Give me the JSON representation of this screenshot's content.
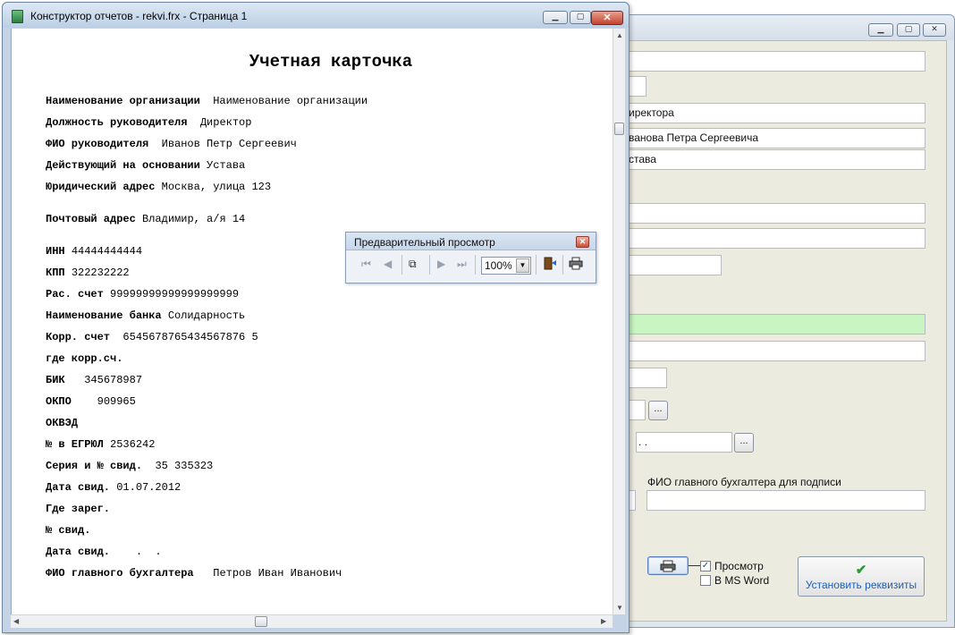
{
  "window": {
    "title": "Конструктор отчетов - rekvi.frx - Страница 1"
  },
  "report": {
    "title": "Учетная карточка",
    "lines": [
      {
        "label": "Наименование организации",
        "value": "Наименование организации"
      },
      {
        "label": "Должность руководителя",
        "value": "Директор"
      },
      {
        "label": "ФИО руководителя",
        "value": "Иванов Петр Сергеевич"
      },
      {
        "label": "Действующий на основании",
        "value": "Устава"
      },
      {
        "label": "Юридический адрес",
        "value": "Москва, улица 123"
      },
      {
        "label": "Почтовый адрес",
        "value": "Владимир, а/я 14"
      },
      {
        "label": "ИНН",
        "value": "44444444444"
      },
      {
        "label": "КПП",
        "value": "322232222"
      },
      {
        "label": "Рас. счет",
        "value": "99999999999999999999"
      },
      {
        "label": "Наименование банка",
        "value": "Солидарность"
      },
      {
        "label": "Корр. счет",
        "value": "6545678765434567876 5"
      },
      {
        "label": "где корр.сч.",
        "value": ""
      },
      {
        "label": "БИК",
        "value": "345678987"
      },
      {
        "label": "ОКПО",
        "value": "909965"
      },
      {
        "label": "ОКВЭД",
        "value": ""
      },
      {
        "label": "№ в ЕГРЮЛ",
        "value": "2536242"
      },
      {
        "label": "Серия и № свид.",
        "value": "35 335323"
      },
      {
        "label": "Дата свид.",
        "value": "01.07.2012"
      },
      {
        "label": "Где зарег.",
        "value": ""
      },
      {
        "label": "№ свид.",
        "value": ""
      },
      {
        "label": "Дата свид.",
        "value": ".  ."
      },
      {
        "label": "ФИО главного бухгалтера",
        "value": "Петров Иван Иванович"
      }
    ]
  },
  "preview_toolbar": {
    "title": "Предварительный просмотр",
    "zoom": "100%",
    "icons": [
      "first-page-icon",
      "prev-page-icon",
      "copy-pages-icon",
      "next-page-icon",
      "last-page-icon",
      "exit-icon",
      "print-icon"
    ]
  },
  "back_form": {
    "fields": {
      "director_position": "иректора",
      "director_name": "ванова Петра Сергеевича",
      "basis": "става",
      "date_field": " .  ."
    },
    "chief_accountant_label": "ФИО главного бухгалтера для подписи",
    "preview_checkbox": {
      "label": "Просмотр",
      "checked": true
    },
    "ms_word_checkbox": {
      "label": "В MS Word",
      "checked": false
    },
    "set_button_label": "Установить реквизиты",
    "dots_label": "..."
  },
  "colors": {
    "green_field": "#c9f5c3",
    "set_button_text": "#1d5fb8",
    "check_green": "#2e9b3a"
  }
}
